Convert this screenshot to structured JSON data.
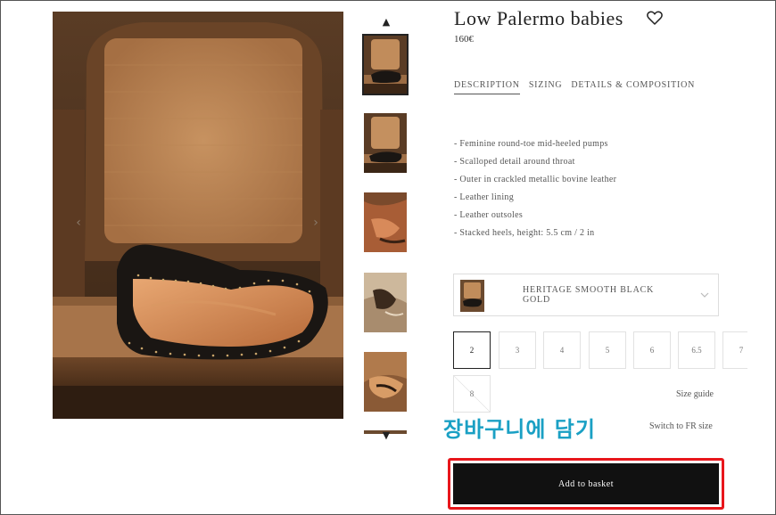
{
  "product": {
    "title": "Low Palermo babies",
    "price": "160€"
  },
  "tabs": [
    {
      "label": "DESCRIPTION",
      "active": true
    },
    {
      "label": "SIZING",
      "active": false
    },
    {
      "label": "DETAILS & COMPOSITION",
      "active": false
    }
  ],
  "description": [
    "- Feminine round-toe mid-heeled pumps",
    "- Scalloped detail around throat",
    "- Outer in crackled metallic bovine leather",
    "- Leather lining",
    "- Leather outsoles",
    "- Stacked heels, height: 5.5 cm / 2 in"
  ],
  "color_select": {
    "selected": "HERITAGE SMOOTH BLACK GOLD"
  },
  "sizes": [
    {
      "label": "2",
      "selected": true,
      "available": true
    },
    {
      "label": "3",
      "selected": false,
      "available": true
    },
    {
      "label": "4",
      "selected": false,
      "available": true
    },
    {
      "label": "5",
      "selected": false,
      "available": true
    },
    {
      "label": "6",
      "selected": false,
      "available": true
    },
    {
      "label": "6.5",
      "selected": false,
      "available": true
    },
    {
      "label": "7",
      "selected": false,
      "available": true
    },
    {
      "label": "8",
      "selected": false,
      "available": false
    }
  ],
  "links": {
    "size_guide": "Size guide",
    "switch_size": "Switch to FR size"
  },
  "annotation": {
    "text": "장바구니에 담기",
    "color": "#1aa0c4",
    "highlight_color": "#e8161b"
  },
  "cta": {
    "add_to_basket": "Add to basket"
  },
  "icons": {
    "thumb_up": "▲",
    "thumb_down": "▼",
    "prev": "‹",
    "next": "›"
  }
}
